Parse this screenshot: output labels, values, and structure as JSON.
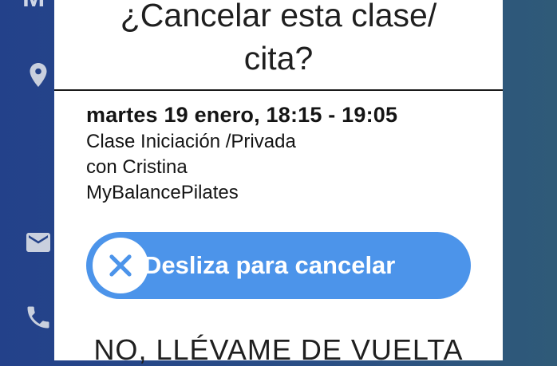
{
  "background": {
    "header_fragment": "M",
    "icons": [
      "location-pin-icon",
      "mail-icon",
      "phone-icon"
    ]
  },
  "modal": {
    "title": "¿Cancelar esta clase/ cita?",
    "appointment": {
      "date_time": "martes 19 enero, 18:15 - 19:05",
      "class_name": "Clase Iniciación /Privada",
      "instructor": "con Cristina",
      "studio": "MyBalancePilates"
    },
    "slider": {
      "label": "Desliza para cancelar",
      "icon": "close-icon",
      "color": "#4c94ea"
    },
    "back_link": "NO, LLÉVAME DE VUELTA"
  }
}
